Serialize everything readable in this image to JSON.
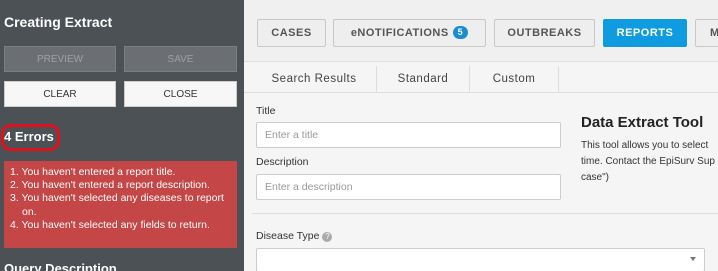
{
  "sidebar": {
    "title": "Creating Extract",
    "buttons": {
      "preview": "PREVIEW",
      "save": "SAVE",
      "clear": "CLEAR",
      "close": "CLOSE"
    },
    "errors_title": "4 Errors",
    "errors": [
      "1. You haven't entered a report title.",
      "2. You haven't entered a report description.",
      "3. You haven't selected any diseases to report",
      "on.",
      "4. You haven't selected any fields to return."
    ],
    "query_title": "Query Description"
  },
  "nav": {
    "cases": "CASES",
    "enotifications": "eNOTIFICATIONS",
    "enotifications_count": "5",
    "outbreaks": "OUTBREAKS",
    "reports": "REPORTS",
    "more": "M"
  },
  "tabs": [
    "Search Results",
    "Standard",
    "Custom"
  ],
  "form": {
    "title_label": "Title",
    "title_placeholder": "Enter a title",
    "description_label": "Description",
    "description_placeholder": "Enter a description",
    "disease_label": "Disease Type",
    "help_icon": "?"
  },
  "tool": {
    "title": "Data Extract Tool",
    "lines": [
      "This tool allows you to select",
      "time. Contact the EpiSurv Sup",
      "case\")"
    ]
  },
  "colors": {
    "sidebar_bg": "#4c5155",
    "active_nav": "#0e9be0",
    "error_bg": "#c44646",
    "error_outline": "#e0101c"
  }
}
